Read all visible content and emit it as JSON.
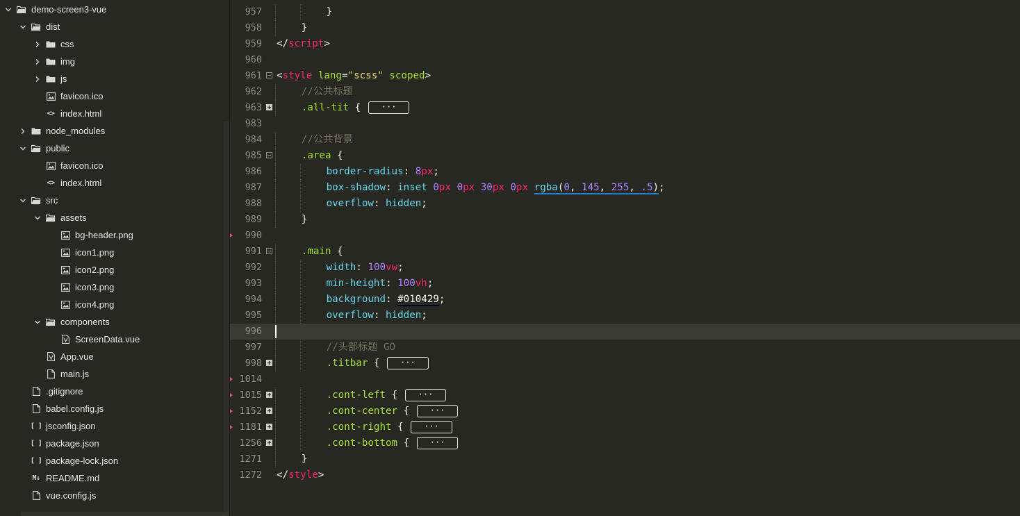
{
  "sidebar": {
    "items": [
      {
        "label": "demo-screen3-vue",
        "depth": 0,
        "kind": "folder",
        "expanded": true
      },
      {
        "label": "dist",
        "depth": 1,
        "kind": "folder",
        "expanded": true
      },
      {
        "label": "css",
        "depth": 2,
        "kind": "folder",
        "expanded": false
      },
      {
        "label": "img",
        "depth": 2,
        "kind": "folder",
        "expanded": false
      },
      {
        "label": "js",
        "depth": 2,
        "kind": "folder",
        "expanded": false
      },
      {
        "label": "favicon.ico",
        "depth": 2,
        "kind": "image"
      },
      {
        "label": "index.html",
        "depth": 2,
        "kind": "code"
      },
      {
        "label": "node_modules",
        "depth": 1,
        "kind": "folder",
        "expanded": false
      },
      {
        "label": "public",
        "depth": 1,
        "kind": "folder",
        "expanded": true
      },
      {
        "label": "favicon.ico",
        "depth": 2,
        "kind": "image"
      },
      {
        "label": "index.html",
        "depth": 2,
        "kind": "code"
      },
      {
        "label": "src",
        "depth": 1,
        "kind": "folder",
        "expanded": true
      },
      {
        "label": "assets",
        "depth": 2,
        "kind": "folder",
        "expanded": true
      },
      {
        "label": "bg-header.png",
        "depth": 3,
        "kind": "image"
      },
      {
        "label": "icon1.png",
        "depth": 3,
        "kind": "image"
      },
      {
        "label": "icon2.png",
        "depth": 3,
        "kind": "image"
      },
      {
        "label": "icon3.png",
        "depth": 3,
        "kind": "image"
      },
      {
        "label": "icon4.png",
        "depth": 3,
        "kind": "image"
      },
      {
        "label": "components",
        "depth": 2,
        "kind": "folder",
        "expanded": true
      },
      {
        "label": "ScreenData.vue",
        "depth": 3,
        "kind": "vue"
      },
      {
        "label": "App.vue",
        "depth": 2,
        "kind": "vue"
      },
      {
        "label": "main.js",
        "depth": 2,
        "kind": "file"
      },
      {
        "label": ".gitignore",
        "depth": 1,
        "kind": "file"
      },
      {
        "label": "babel.config.js",
        "depth": 1,
        "kind": "file"
      },
      {
        "label": "jsconfig.json",
        "depth": 1,
        "kind": "json"
      },
      {
        "label": "package.json",
        "depth": 1,
        "kind": "json"
      },
      {
        "label": "package-lock.json",
        "depth": 1,
        "kind": "json"
      },
      {
        "label": "README.md",
        "depth": 1,
        "kind": "md"
      },
      {
        "label": "vue.config.js",
        "depth": 1,
        "kind": "file"
      }
    ],
    "icon_text": {
      "json": "[ ]",
      "code": "<>",
      "md": "M↓"
    }
  },
  "editor": {
    "lines": [
      {
        "n": "957",
        "indent": 2,
        "fold": "",
        "tokens": [
          [
            "}",
            "punc"
          ]
        ]
      },
      {
        "n": "958",
        "indent": 1,
        "fold": "",
        "tokens": [
          [
            "}",
            "punc"
          ]
        ]
      },
      {
        "n": "959",
        "indent": 0,
        "fold": "",
        "tokens": [
          [
            "</",
            "punc"
          ],
          [
            "script",
            "tag"
          ],
          [
            ">",
            "punc"
          ]
        ]
      },
      {
        "n": "960",
        "indent": 0,
        "fold": "",
        "tokens": []
      },
      {
        "n": "961",
        "indent": 0,
        "fold": "open",
        "tokens": [
          [
            "<",
            "punc"
          ],
          [
            "style",
            "tag"
          ],
          [
            " ",
            "punc"
          ],
          [
            "lang",
            "attr"
          ],
          [
            "=",
            "punc"
          ],
          [
            "\"scss\"",
            "str"
          ],
          [
            " ",
            "punc"
          ],
          [
            "scoped",
            "attr"
          ],
          [
            ">",
            "punc"
          ]
        ]
      },
      {
        "n": "962",
        "indent": 1,
        "fold": "",
        "tokens": [
          [
            "//公共标题",
            "cmt"
          ]
        ]
      },
      {
        "n": "963",
        "indent": 1,
        "fold": "closed",
        "tokens": [
          [
            ".all-tit",
            "sel"
          ],
          [
            " { ",
            "punc"
          ],
          [
            "···",
            "dots"
          ]
        ]
      },
      {
        "n": "983",
        "indent": 0,
        "fold": "",
        "tokens": []
      },
      {
        "n": "984",
        "indent": 1,
        "fold": "",
        "tokens": [
          [
            "//公共背景",
            "cmt"
          ]
        ]
      },
      {
        "n": "985",
        "indent": 1,
        "fold": "open",
        "tokens": [
          [
            ".area",
            "sel"
          ],
          [
            " {",
            "punc"
          ]
        ]
      },
      {
        "n": "986",
        "indent": 2,
        "fold": "",
        "tokens": [
          [
            "border-radius",
            "prop"
          ],
          [
            ": ",
            "punc"
          ],
          [
            "8",
            "num"
          ],
          [
            "px",
            "unit"
          ],
          [
            ";",
            "punc"
          ]
        ]
      },
      {
        "n": "987",
        "indent": 2,
        "fold": "",
        "tokens": [
          [
            "box-shadow",
            "prop"
          ],
          [
            ": ",
            "punc"
          ],
          [
            "inset",
            "kw"
          ],
          [
            " ",
            "punc"
          ],
          [
            "0",
            "num"
          ],
          [
            "px",
            "unit"
          ],
          [
            " ",
            "punc"
          ],
          [
            "0",
            "num"
          ],
          [
            "px",
            "unit"
          ],
          [
            " ",
            "punc"
          ],
          [
            "30",
            "num"
          ],
          [
            "px",
            "unit"
          ],
          [
            " ",
            "punc"
          ],
          [
            "0",
            "num"
          ],
          [
            "px",
            "unit"
          ],
          [
            " ",
            "punc"
          ],
          [
            "rgba",
            "fnrgba"
          ],
          [
            "(",
            "rgbap"
          ],
          [
            "0",
            "rgban"
          ],
          [
            ", ",
            "rgbap"
          ],
          [
            "145",
            "rgban"
          ],
          [
            ", ",
            "rgbap"
          ],
          [
            "255",
            "rgban"
          ],
          [
            ", ",
            "rgbap"
          ],
          [
            ".5",
            "rgban"
          ],
          [
            ")",
            "rgbap"
          ],
          [
            ";",
            "punc"
          ]
        ]
      },
      {
        "n": "988",
        "indent": 2,
        "fold": "",
        "tokens": [
          [
            "overflow",
            "prop"
          ],
          [
            ": ",
            "punc"
          ],
          [
            "hidden",
            "kw"
          ],
          [
            ";",
            "punc"
          ]
        ]
      },
      {
        "n": "989",
        "indent": 1,
        "fold": "",
        "tokens": [
          [
            "}",
            "punc"
          ]
        ]
      },
      {
        "n": "990",
        "indent": 0,
        "fold": "",
        "tokens": []
      },
      {
        "n": "991",
        "indent": 1,
        "fold": "open",
        "tokens": [
          [
            ".main",
            "sel"
          ],
          [
            " {",
            "punc"
          ]
        ]
      },
      {
        "n": "992",
        "indent": 2,
        "fold": "",
        "tokens": [
          [
            "width",
            "prop"
          ],
          [
            ": ",
            "punc"
          ],
          [
            "100",
            "num"
          ],
          [
            "vw",
            "unit"
          ],
          [
            ";",
            "punc"
          ]
        ]
      },
      {
        "n": "993",
        "indent": 2,
        "fold": "",
        "tokens": [
          [
            "min-height",
            "prop"
          ],
          [
            ": ",
            "punc"
          ],
          [
            "100",
            "num"
          ],
          [
            "vh",
            "unit"
          ],
          [
            ";",
            "punc"
          ]
        ]
      },
      {
        "n": "994",
        "indent": 2,
        "fold": "",
        "tokens": [
          [
            "background",
            "prop"
          ],
          [
            ": ",
            "punc"
          ],
          [
            "#010429",
            "hexu"
          ],
          [
            ";",
            "punc"
          ]
        ]
      },
      {
        "n": "995",
        "indent": 2,
        "fold": "",
        "tokens": [
          [
            "overflow",
            "prop"
          ],
          [
            ": ",
            "punc"
          ],
          [
            "hidden",
            "kw"
          ],
          [
            ";",
            "punc"
          ]
        ]
      },
      {
        "n": "996",
        "indent": 0,
        "fold": "",
        "tokens": [],
        "current": true
      },
      {
        "n": "997",
        "indent": 2,
        "fold": "",
        "tokens": [
          [
            "//头部标题 GO",
            "cmt"
          ]
        ]
      },
      {
        "n": "998",
        "indent": 2,
        "fold": "closed",
        "tokens": [
          [
            ".titbar",
            "sel"
          ],
          [
            " { ",
            "punc"
          ],
          [
            "···",
            "dots"
          ]
        ]
      },
      {
        "n": "1014",
        "indent": 0,
        "fold": "",
        "tokens": []
      },
      {
        "n": "1015",
        "indent": 2,
        "fold": "closed",
        "tokens": [
          [
            ".cont-left",
            "sel"
          ],
          [
            " { ",
            "punc"
          ],
          [
            "···",
            "dots"
          ]
        ]
      },
      {
        "n": "1152",
        "indent": 2,
        "fold": "closed",
        "tokens": [
          [
            ".cont-center",
            "sel"
          ],
          [
            " { ",
            "punc"
          ],
          [
            "···",
            "dots"
          ]
        ]
      },
      {
        "n": "1181",
        "indent": 2,
        "fold": "closed",
        "tokens": [
          [
            ".cont-right",
            "sel"
          ],
          [
            " { ",
            "punc"
          ],
          [
            "···",
            "dots"
          ]
        ]
      },
      {
        "n": "1256",
        "indent": 2,
        "fold": "closed",
        "tokens": [
          [
            ".cont-bottom",
            "sel"
          ],
          [
            " { ",
            "punc"
          ],
          [
            "···",
            "dots"
          ]
        ]
      },
      {
        "n": "1271",
        "indent": 1,
        "fold": "",
        "tokens": [
          [
            "}",
            "punc"
          ]
        ]
      },
      {
        "n": "1272",
        "indent": 0,
        "fold": "",
        "tokens": [
          [
            "</",
            "punc"
          ],
          [
            "style",
            "tag"
          ],
          [
            ">",
            "punc"
          ]
        ]
      }
    ],
    "gutter_marks_after_line": [
      "990",
      "1014",
      "1015",
      "1152",
      "1181"
    ],
    "colors": {
      "background": "#272822",
      "current_line": "#3a3b35",
      "tag": "#f92672",
      "comment": "#75715e",
      "selector": "#a6e22e",
      "property": "#66d9ef",
      "number": "#ae81ff"
    }
  }
}
